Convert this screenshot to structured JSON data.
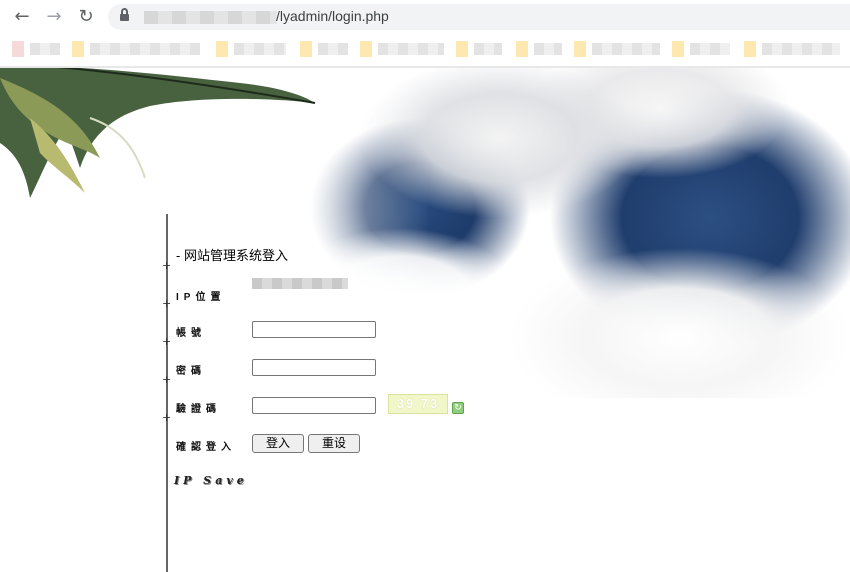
{
  "browser": {
    "back_icon": "arrow-left-icon",
    "forward_icon": "arrow-right-icon",
    "reload_icon": "reload-icon",
    "lock_icon": "lock-icon",
    "url_path": "/lyadmin/login.php"
  },
  "login": {
    "title": "- 网站管理系统登入",
    "ip_label": "IP位置",
    "account_label": "帳號",
    "password_label": "密碼",
    "captcha_label": "驗證碼",
    "confirm_label": "確認登入",
    "captcha_text": "39 73",
    "refresh_icon": "refresh-icon",
    "login_button": "登入",
    "reset_button": "重设",
    "signature": "IP Save"
  }
}
